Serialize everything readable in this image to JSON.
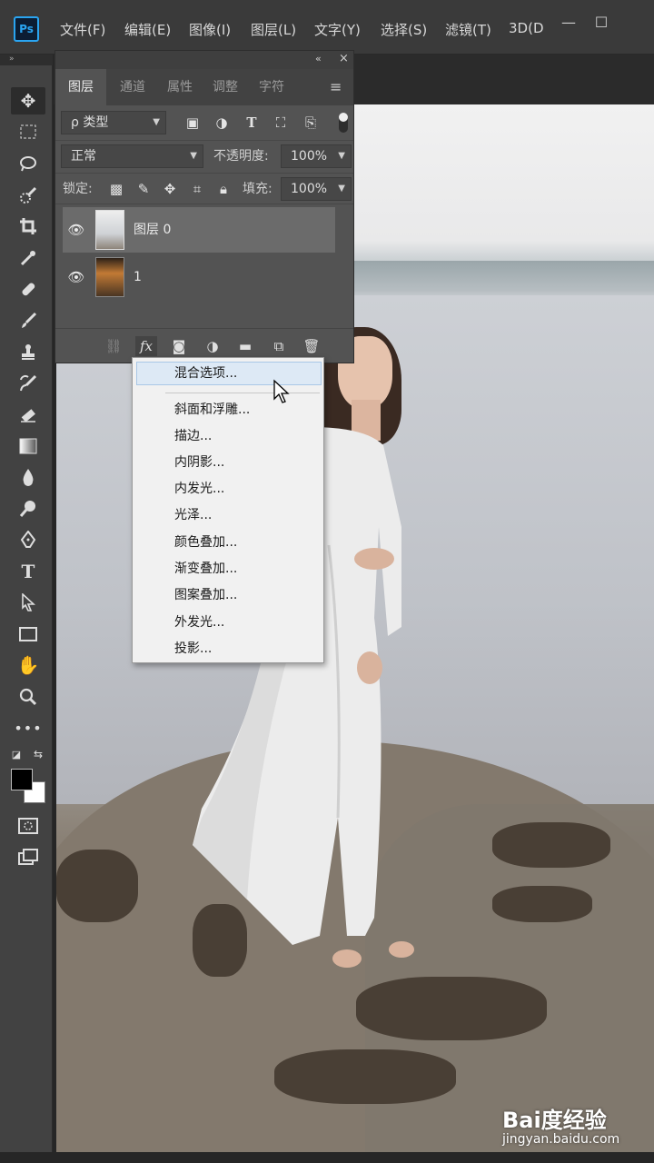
{
  "app": {
    "logo": "Ps"
  },
  "menubar": {
    "items": [
      "文件(F)",
      "编辑(E)",
      "图像(I)",
      "图层(L)",
      "文字(Y)",
      "选择(S)",
      "滤镜(T)",
      "3D(D"
    ]
  },
  "window_controls": {
    "minimize": "—",
    "maximize": "☐",
    "collapse": "»"
  },
  "panel": {
    "collapse_label": "«",
    "close_label": "×",
    "tabs": [
      "图层",
      "通道",
      "属性",
      "调整",
      "字符"
    ],
    "menu_icon": "≡",
    "filter": {
      "value": "ρ 类型"
    },
    "blend_mode": "正常",
    "opacity_label": "不透明度:",
    "opacity_value": "100%",
    "lock_label": "锁定:",
    "fill_label": "填充:",
    "fill_value": "100%",
    "layers": [
      {
        "name": "图层 0",
        "selected": true,
        "visible": true
      },
      {
        "name": "1",
        "selected": false,
        "visible": true
      }
    ]
  },
  "fx_menu": {
    "items": [
      "混合选项...",
      "斜面和浮雕...",
      "描边...",
      "内阴影...",
      "内发光...",
      "光泽...",
      "颜色叠加...",
      "渐变叠加...",
      "图案叠加...",
      "外发光...",
      "投影..."
    ],
    "highlighted": "混合选项..."
  },
  "watermark": {
    "logo": "Bai度经验",
    "url": "jingyan.baidu.com"
  },
  "colors": {
    "ps_blue": "#2aa4f0",
    "panel_bg": "#535353",
    "menu_bg": "#f1f1f1",
    "highlight": "#dde9f5"
  }
}
